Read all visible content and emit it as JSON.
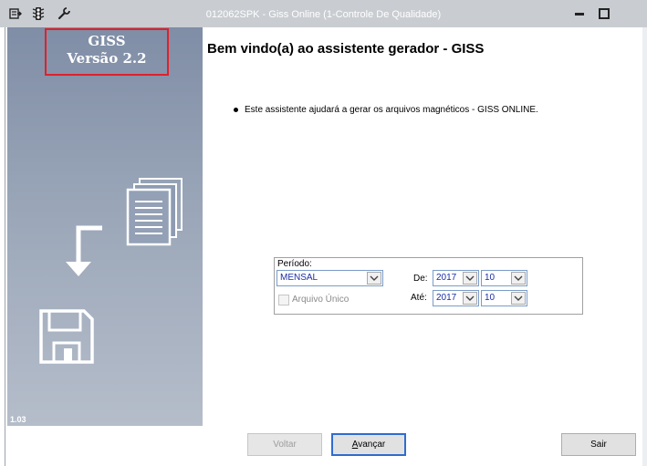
{
  "window": {
    "title": "012062SPK - Giss Online (1-Controle De Qualidade)",
    "icons": [
      "export-icon",
      "traffic-light-icon",
      "wrench-icon"
    ],
    "controls": [
      "minimize-icon",
      "maximize-icon"
    ]
  },
  "side_panel": {
    "product": "GISS",
    "version_label": "Versão 2.2",
    "app_version": "1.03",
    "illustrations": [
      "documents-icon",
      "arrow-down-icon",
      "floppy-disk-icon"
    ],
    "highlight_color": "#e0202a"
  },
  "main": {
    "heading": "Bem vindo(a) ao assistente gerador - GISS",
    "intro": "Este assistente ajudará a gerar os arquivos magnéticos - GISS ONLINE."
  },
  "period": {
    "label": "Período:",
    "type_value": "MENSAL",
    "single_file_label": "Arquivo Único",
    "single_file_checked": false,
    "from_label": "De:",
    "from_year": "2017",
    "from_month": "10",
    "to_label": "Até:",
    "to_year": "2017",
    "to_month": "10"
  },
  "buttons": {
    "back": "Voltar",
    "next_first": "A",
    "next_rest": "vançar",
    "exit": "Sair"
  }
}
